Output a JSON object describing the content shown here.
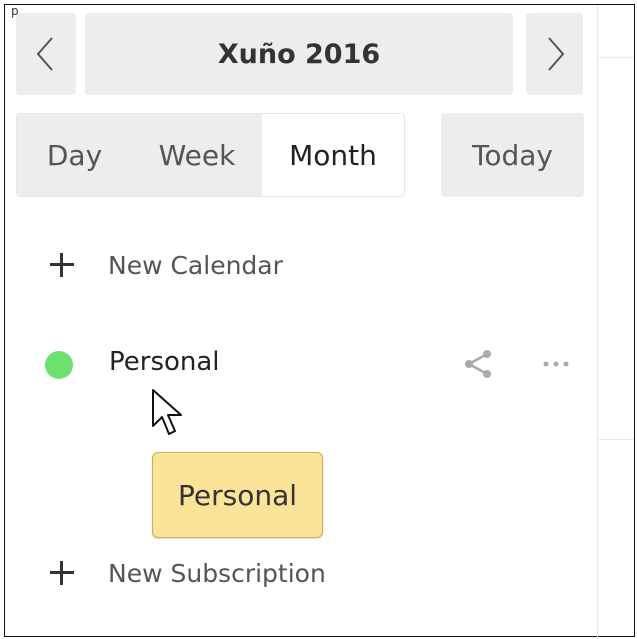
{
  "header": {
    "top_label": "p",
    "month_title": "Xuño 2016"
  },
  "views": {
    "day": "Day",
    "week": "Week",
    "month": "Month",
    "selected": "Month",
    "today": "Today"
  },
  "sidebar": {
    "new_calendar": "New Calendar",
    "calendars": [
      {
        "name": "Personal",
        "color": "#6ee06f"
      }
    ],
    "new_subscription": "New Subscription"
  },
  "tooltip": {
    "text": "Personal"
  },
  "icons": {
    "prev": "chevron-left-icon",
    "next": "chevron-right-icon",
    "add": "plus-icon",
    "share": "share-icon",
    "more": "more-horizontal-icon",
    "cursor": "mouse-pointer-icon"
  }
}
